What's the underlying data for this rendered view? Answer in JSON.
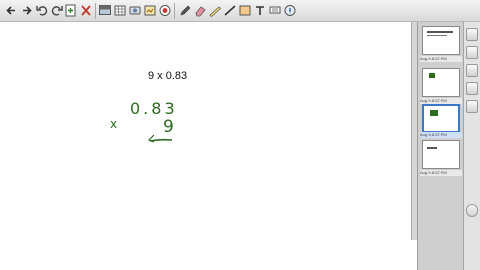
{
  "toolbar": {
    "icons": [
      "back-icon",
      "forward-icon",
      "undo-icon",
      "redo-icon",
      "add-page-icon",
      "delete-icon",
      "screen-shade-icon",
      "table-icon",
      "document-camera-icon",
      "capture-icon",
      "recorder-icon",
      "pen-icon",
      "eraser-icon",
      "highlighter-icon",
      "line-icon",
      "shape-icon",
      "text-icon",
      "fill-icon",
      "properties-icon",
      "menu-icon"
    ]
  },
  "canvas": {
    "question": "9 x 0.83",
    "multiplication": {
      "operator": "x",
      "top": "0.83",
      "bottom": "9"
    },
    "ink_color": "#2e6b1f"
  },
  "page_sorter": {
    "pages": [
      {
        "label": "Aug 9-8:22 PM",
        "selected": false
      },
      {
        "label": "Aug 9-8:22 PM",
        "selected": false
      },
      {
        "label": "Aug 9-8:22 PM",
        "selected": true
      },
      {
        "label": "Aug 9-8:22 PM",
        "selected": false
      }
    ]
  }
}
